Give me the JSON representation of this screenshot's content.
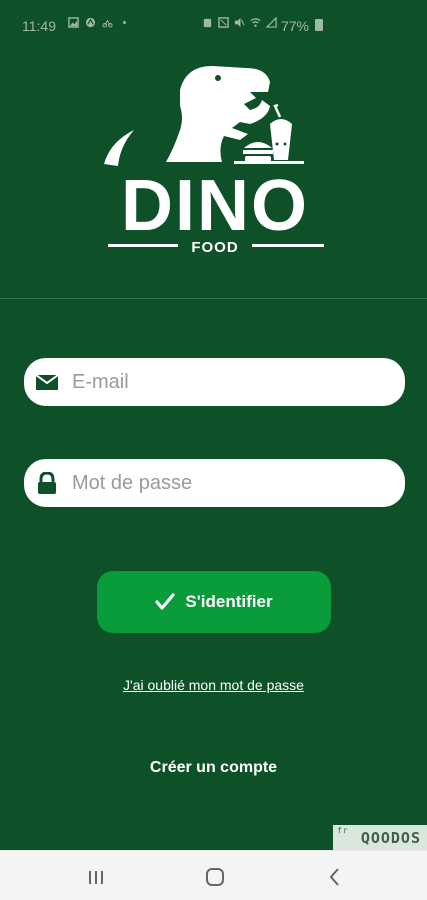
{
  "status_bar": {
    "time": "11:49",
    "battery": "77%"
  },
  "logo": {
    "brand": "DINO",
    "subtitle": "FOOD"
  },
  "form": {
    "email_placeholder": "E-mail",
    "password_placeholder": "Mot de passe",
    "login_label": "S'identifier",
    "forgot_label": "J'ai oublié mon mot de passe",
    "create_account_label": "Créer un compte"
  },
  "watermark": {
    "prefix": "fr",
    "text": "QOODOS"
  },
  "colors": {
    "background": "#0e5128",
    "button": "#0a9b3a",
    "field": "#ffffff",
    "nav_bar": "#f4f4f4"
  }
}
